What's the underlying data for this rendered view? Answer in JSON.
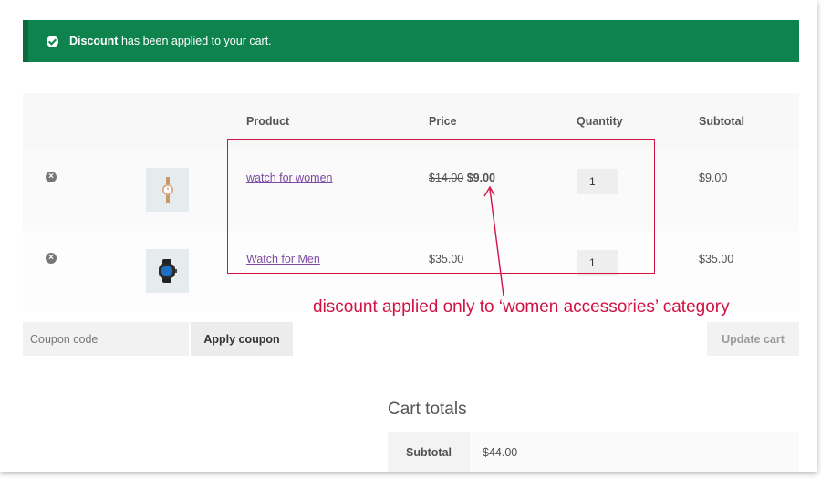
{
  "notice": {
    "bold": "Discount",
    "rest": " has been applied to your cart."
  },
  "table": {
    "headers": {
      "product": "Product",
      "price": "Price",
      "quantity": "Quantity",
      "subtotal": "Subtotal"
    },
    "rows": [
      {
        "name": "watch for women",
        "price_original": "$14.00",
        "price_sale": "$9.00",
        "price": "",
        "quantity": "1",
        "subtotal": "$9.00",
        "remove_icon": "remove-icon",
        "thumb_icon": "women-watch-icon"
      },
      {
        "name": "Watch for Men",
        "price_original": "",
        "price_sale": "",
        "price": "$35.00",
        "quantity": "1",
        "subtotal": "$35.00",
        "remove_icon": "remove-icon",
        "thumb_icon": "men-watch-icon"
      }
    ]
  },
  "coupon": {
    "placeholder": "Coupon code",
    "apply_label": "Apply coupon"
  },
  "update_label": "Update cart",
  "totals": {
    "title": "Cart totals",
    "subtotal_label": "Subtotal",
    "subtotal_value": "$44.00"
  },
  "annotation": {
    "text": "discount applied only to ‘women accessories’ category",
    "color": "#d11143"
  },
  "colors": {
    "notice_bg": "#0f834d",
    "link": "#7e4aa3"
  }
}
